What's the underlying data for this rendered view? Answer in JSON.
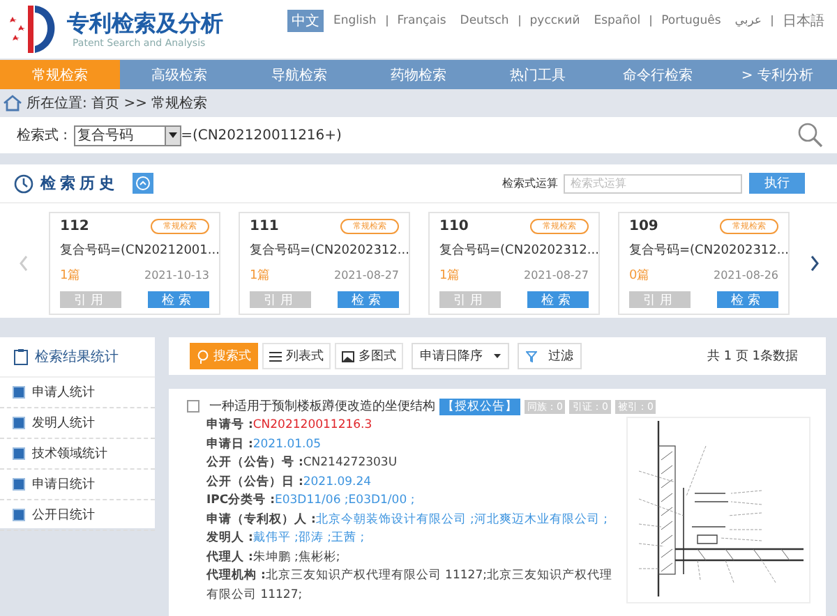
{
  "header": {
    "title": "专利检索及分析",
    "subtitle": "Patent Search and Analysis",
    "languages": [
      {
        "label": "中文",
        "selected": true
      },
      {
        "label": "English",
        "selected": false
      },
      {
        "label": "Français",
        "selected": false
      },
      {
        "label": "Deutsch",
        "selected": false
      },
      {
        "label": "русский",
        "selected": false
      },
      {
        "label": "Español",
        "selected": false
      },
      {
        "label": "Português",
        "selected": false
      },
      {
        "label": "عربي",
        "selected": false
      },
      {
        "label": "日本語",
        "selected": false
      }
    ]
  },
  "nav": [
    {
      "label": "常规检索",
      "selected": true
    },
    {
      "label": "高级检索",
      "selected": false
    },
    {
      "label": "导航检索",
      "selected": false
    },
    {
      "label": "药物检索",
      "selected": false
    },
    {
      "label": "热门工具",
      "selected": false
    },
    {
      "label": "命令行检索",
      "selected": false
    },
    {
      "label": "> 专利分析",
      "selected": false
    }
  ],
  "breadcrumb": "所在位置: 首页 >> 常规检索",
  "search": {
    "label": "检索式 :",
    "field": "复合号码",
    "expression": "=(CN202120011216+)"
  },
  "history": {
    "title": "检索历史",
    "operation_label": "检索式运算",
    "operation_placeholder": "检索式运算",
    "execute": "执行",
    "prev_disabled": true,
    "next_disabled": false,
    "cards": [
      {
        "number": "112",
        "badge": "常规检索",
        "query": "复合号码=(CN20212001...",
        "count": "1篇",
        "date": "2021-10-13",
        "cite": "引用",
        "search": "检索"
      },
      {
        "number": "111",
        "badge": "常规检索",
        "query": "复合号码=(CN20202312...",
        "count": "1篇",
        "date": "2021-08-27",
        "cite": "引用",
        "search": "检索"
      },
      {
        "number": "110",
        "badge": "常规检索",
        "query": "复合号码=(CN20202312...",
        "count": "1篇",
        "date": "2021-08-27",
        "cite": "引用",
        "search": "检索"
      },
      {
        "number": "109",
        "badge": "常规检索",
        "query": "复合号码=(CN20202312...",
        "count": "0篇",
        "date": "2021-08-26",
        "cite": "引用",
        "search": "检索"
      }
    ]
  },
  "stats": {
    "title": "检索结果统计",
    "items": [
      "申请人统计",
      "发明人统计",
      "技术领域统计",
      "申请日统计",
      "公开日统计"
    ]
  },
  "toolbar": {
    "views": [
      {
        "label": "搜索式",
        "selected": true,
        "kind": "search"
      },
      {
        "label": "列表式",
        "selected": false,
        "kind": "list"
      },
      {
        "label": "多图式",
        "selected": false,
        "kind": "image"
      }
    ],
    "sort": "申请日降序",
    "filter": "过滤",
    "summary": "共 1 页 1条数据"
  },
  "result": {
    "checked": false,
    "title": "一种适用于预制楼板蹲便改造的坐便结构",
    "status": "【授权公告】",
    "counters": [
      "同族：0",
      "引证：0",
      "被引：0"
    ],
    "fields": [
      {
        "label": "申请号 :",
        "value": "CN202120011216.3",
        "kind": "id"
      },
      {
        "label": "申请日 :",
        "value": "2021.01.05",
        "kind": "link"
      },
      {
        "label": "公开（公告）号 :",
        "value": "CN214272303U",
        "kind": "plain"
      },
      {
        "label": "公开（公告）日 :",
        "value": "2021.09.24",
        "kind": "link"
      },
      {
        "label": "IPC分类号 :",
        "value": "E03D11/06 ;E03D1/00 ;",
        "kind": "link"
      },
      {
        "label": "申请（专利权）人 :",
        "value": "北京今朝装饰设计有限公司 ;河北爽迈木业有限公司 ;",
        "kind": "link"
      },
      {
        "label": "发明人 :",
        "value": "戴伟平 ;邵涛 ;王茜 ;",
        "kind": "link"
      },
      {
        "label": "代理人 :",
        "value": "朱坤鹏 ;焦彬彬;",
        "kind": "plain"
      },
      {
        "label": "代理机构 :",
        "value": "北京三友知识产权代理有限公司 11127;北京三友知识产权代理有限公司 11127;",
        "kind": "plain"
      }
    ]
  }
}
